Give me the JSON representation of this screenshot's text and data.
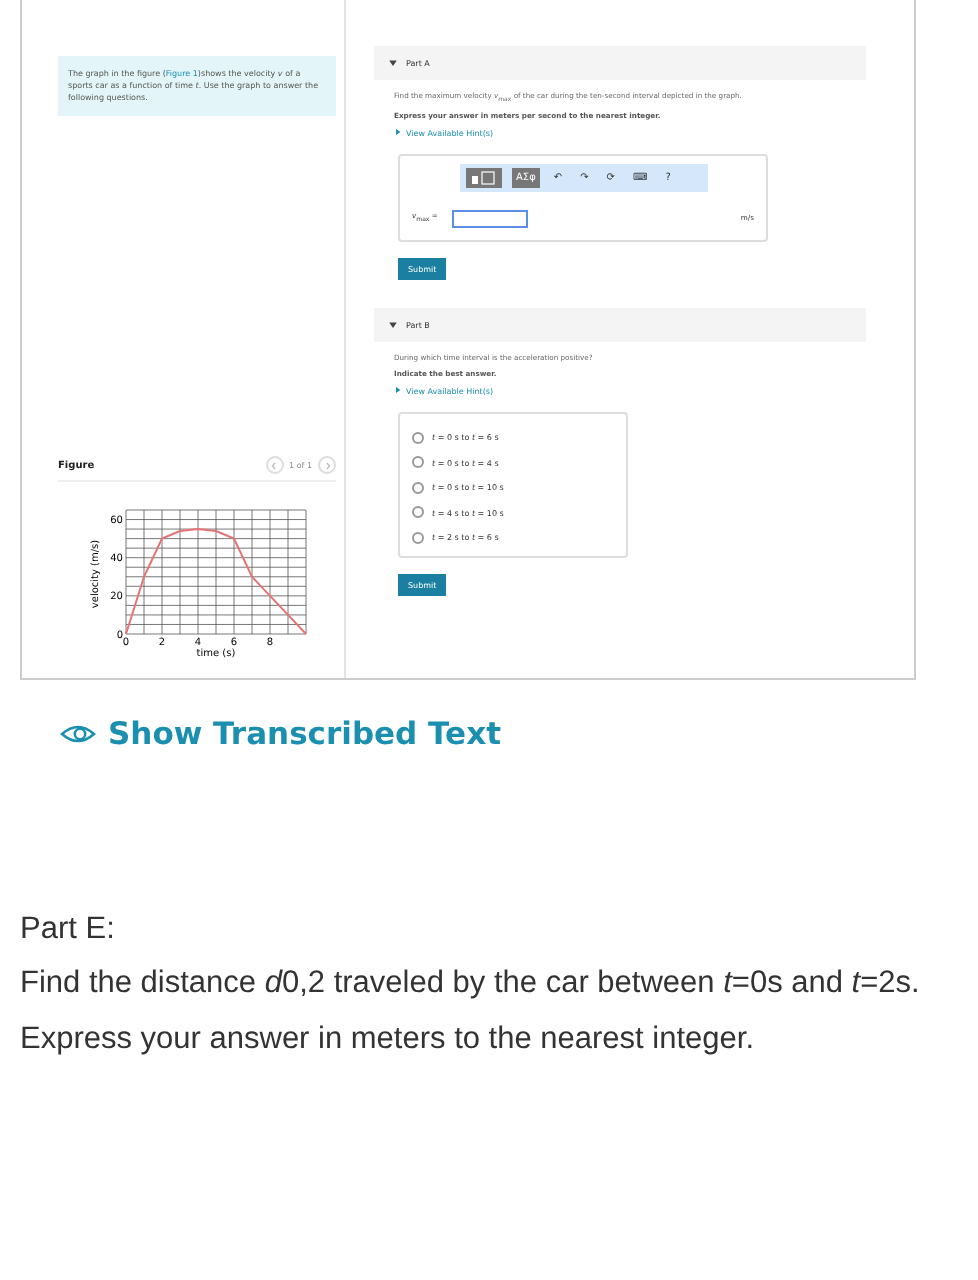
{
  "intro": {
    "before": "The graph in the figure (",
    "link": "Figure 1",
    "after": ")shows the velocity *v* of a sports car as a function of time *t*. Use the graph to answer the following questions."
  },
  "figure": {
    "title": "Figure",
    "pager": "1 of 1",
    "chart_data": {
      "type": "line",
      "xlabel": "time (s)",
      "ylabel": "velocity (m/s)",
      "x": [
        0,
        1,
        2,
        3,
        4,
        5,
        6,
        7,
        8,
        9,
        10
      ],
      "grid": true,
      "series": [
        {
          "color": "#e57373",
          "values": [
            0,
            30,
            50,
            54,
            55,
            54,
            50,
            30,
            20,
            10,
            0
          ]
        }
      ],
      "xlim": [
        0,
        10
      ],
      "ylim": [
        0,
        65
      ],
      "xticks": [
        0,
        2,
        4,
        6,
        8
      ],
      "yticks": [
        0,
        20,
        40,
        60
      ]
    }
  },
  "parts": [
    {
      "title": "Part A",
      "expanded": true,
      "kind": "numeric",
      "question": "Find the maximum velocity *v*$_{max}$ of the car during the ten-second interval depicted in the graph.",
      "instruction": "Express your answer in meters per second to the nearest integer.",
      "hint": "View Available Hint(s)",
      "toolbar": [
        "ΑΣφ",
        "↶",
        "↷",
        "⟳",
        "⌨",
        "?"
      ],
      "answer_label": "*v*$_{max}$ =",
      "unit": "m/s",
      "submit": "Submit"
    },
    {
      "title": "Part B",
      "expanded": true,
      "kind": "choice",
      "question": "During which time interval is the acceleration positive?",
      "instruction": "Indicate the best answer.",
      "hint": "View Available Hint(s)",
      "options": [
        {
          "label": "*t* = 0 s to *t* = 6 s",
          "selected": false
        },
        {
          "label": "*t* = 0 s to *t* = 4 s",
          "selected": false
        },
        {
          "label": "*t* = 0 s to *t* = 10 s",
          "selected": false
        },
        {
          "label": "*t* = 4 s to *t* = 10 s",
          "selected": false
        },
        {
          "label": "*t* = 2 s to *t* = 6 s",
          "selected": false
        }
      ],
      "submit": "Submit"
    }
  ],
  "transcribed_link": "Show Transcribed Text",
  "part_e": {
    "title": "Part E:",
    "question": [
      {
        "text": "Find the distance ",
        "italic": false
      },
      {
        "text": "d",
        "italic": true
      },
      {
        "text": "0,2 traveled by the car between ",
        "italic": false
      },
      {
        "text": "t",
        "italic": true
      },
      {
        "text": "=0s and ",
        "italic": false
      },
      {
        "text": "t",
        "italic": true
      },
      {
        "text": "=2s.",
        "italic": false
      }
    ],
    "instruction": "Express your answer in meters to the nearest integer."
  }
}
